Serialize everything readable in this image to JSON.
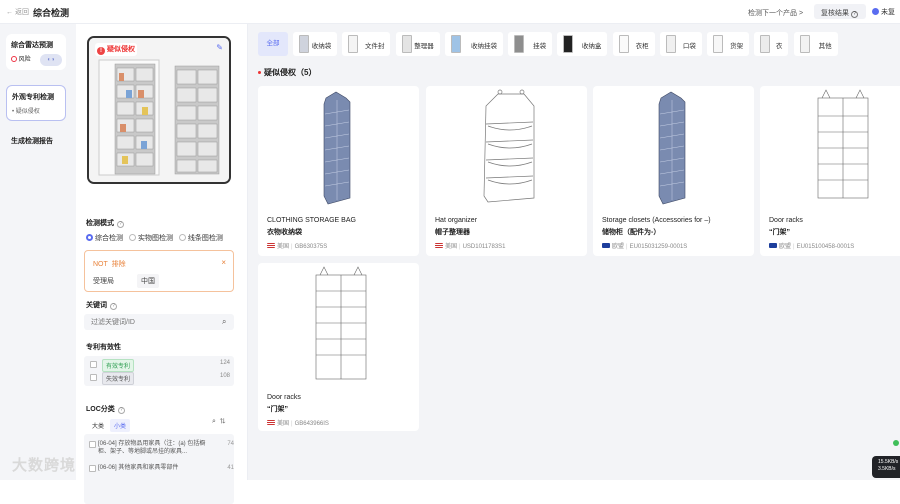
{
  "header": {
    "back_label": "← 返回",
    "title": "综合检测",
    "next_product_label": "检测下一个产品 >",
    "results_label": "复核结果",
    "recheck_label": "未复"
  },
  "left_nav": {
    "items": [
      {
        "label": "综合雷达预测",
        "sub": "风险"
      },
      {
        "label": "外观专利检测",
        "sub": "• 疑似侵权"
      },
      {
        "label": "生成检测报告"
      }
    ]
  },
  "filters": {
    "suspect_badge": "疑似侵权",
    "mode_label": "检测模式",
    "modes": [
      "综合检测",
      "实物图检测",
      "线条图检测"
    ],
    "selected_mode": "综合检测",
    "not_label": "NOT",
    "not_value": "排除",
    "office_label": "受理局",
    "office_value": "中国",
    "keyword_label": "关键词",
    "keyword_placeholder": "过滤关键词/ID",
    "validity_label": "专利有效性",
    "validity": [
      {
        "label": "有效专利",
        "count": "124",
        "color": "#2f9e52",
        "bg": "#e3f5e8"
      },
      {
        "label": "失效专利",
        "count": "108",
        "color": "#555555",
        "bg": "#e8e9ee"
      }
    ],
    "loc_label": "LOC分类",
    "loc_tabs": [
      "大类",
      "小类"
    ],
    "loc_tab_selected": "小类",
    "loc_items": [
      {
        "text": "[06-04] 存放物品用家具（注：(a) 包括橱柜、架子、等地脚或吊挂的家具...",
        "count": "74"
      },
      {
        "text": "[06-06] 其他家具和家具零部件",
        "count": "41"
      }
    ]
  },
  "categories": [
    "全部",
    "收纳袋",
    "文件封",
    "整理器",
    "收纳挂袋",
    "挂袋",
    "收纳盒",
    "衣柜",
    "口袋",
    "货架",
    "衣",
    "其他"
  ],
  "results": {
    "section_title": "疑似侵权（5）",
    "cards": [
      {
        "en": "CLOTHING STORAGE BAG",
        "cn": "衣物收纳袋",
        "region": "美国",
        "id": "GB630375S",
        "flag": "us"
      },
      {
        "en": "Hat organizer",
        "cn": "帽子整理器",
        "region": "美国",
        "id": "USD1011783S1",
        "flag": "us"
      },
      {
        "en": "Storage closets (Accessories for –)",
        "cn": "储物柜（配件为-）",
        "region": "欧盟",
        "id": "EU015031259-0001S",
        "flag": "eu"
      },
      {
        "en": "Door racks",
        "cn": "“门架”",
        "region": "欧盟",
        "id": "EU015100458-0001S",
        "flag": "eu"
      },
      {
        "en": "Door racks",
        "cn": "“门架”",
        "region": "美国",
        "id": "GB643966IS",
        "flag": "us"
      }
    ]
  },
  "watermark": "大数跨境",
  "status_badge": {
    "line1": "15.5KB/s",
    "line2": "3.5KB/s"
  }
}
